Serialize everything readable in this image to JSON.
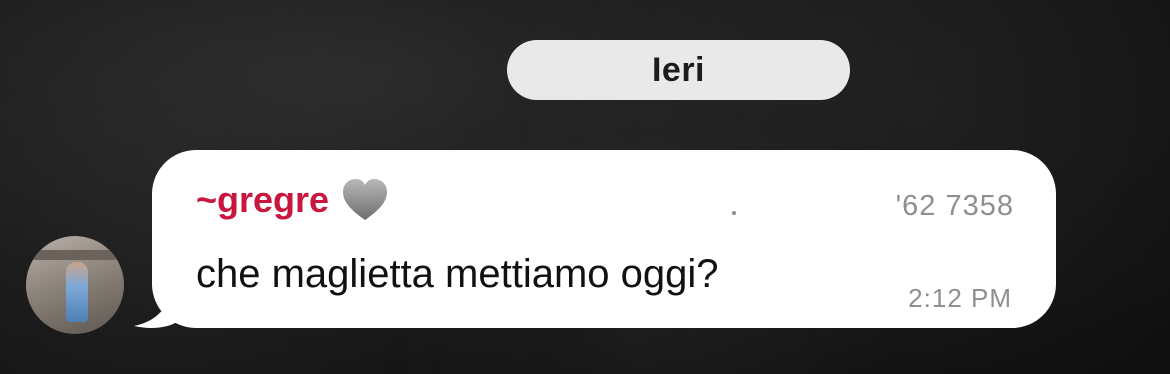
{
  "date_separator": "Ieri",
  "message": {
    "sender_name": "~gregre",
    "sender_emoji": "grey-heart-icon",
    "sender_color": "#c8163e",
    "phone_partial": "'62 7358",
    "text": "che maglietta mettiamo oggi?",
    "time": "2:12 PM"
  },
  "colors": {
    "bubble": "#ffffff",
    "pill": "#e9e9ea",
    "meta_text": "#8e8e93"
  }
}
